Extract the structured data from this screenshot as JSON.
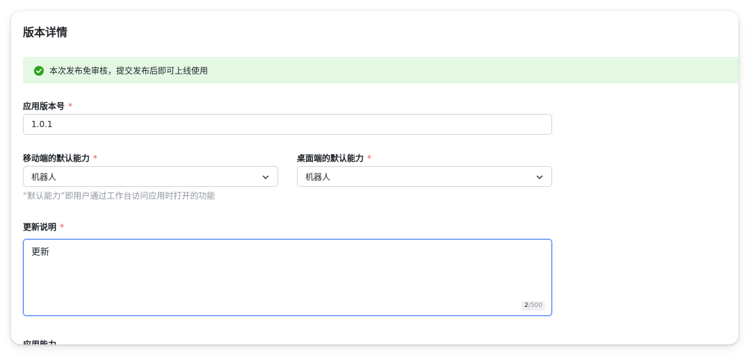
{
  "page": {
    "title": "版本详情"
  },
  "notice": {
    "icon": "check-circle-icon",
    "text": "本次发布免审核，提交发布后即可上线使用",
    "bg_color": "#e4f8e3",
    "icon_color": "#2ea121"
  },
  "form": {
    "required_mark": "*",
    "version": {
      "label": "应用版本号",
      "value": "1.0.1"
    },
    "mobile_default": {
      "label": "移动端的默认能力",
      "selected": "机器人"
    },
    "desktop_default": {
      "label": "桌面端的默认能力",
      "selected": "机器人"
    },
    "default_hint": "“默认能力”即用户通过工作台访问应用时打开的功能",
    "update_notes": {
      "label": "更新说明",
      "value": "更新",
      "count_current": "2",
      "count_max": "/500"
    },
    "capabilities": {
      "label": "应用能力"
    }
  },
  "colors": {
    "required": "#f54a45",
    "focus_border": "#3370ff"
  }
}
